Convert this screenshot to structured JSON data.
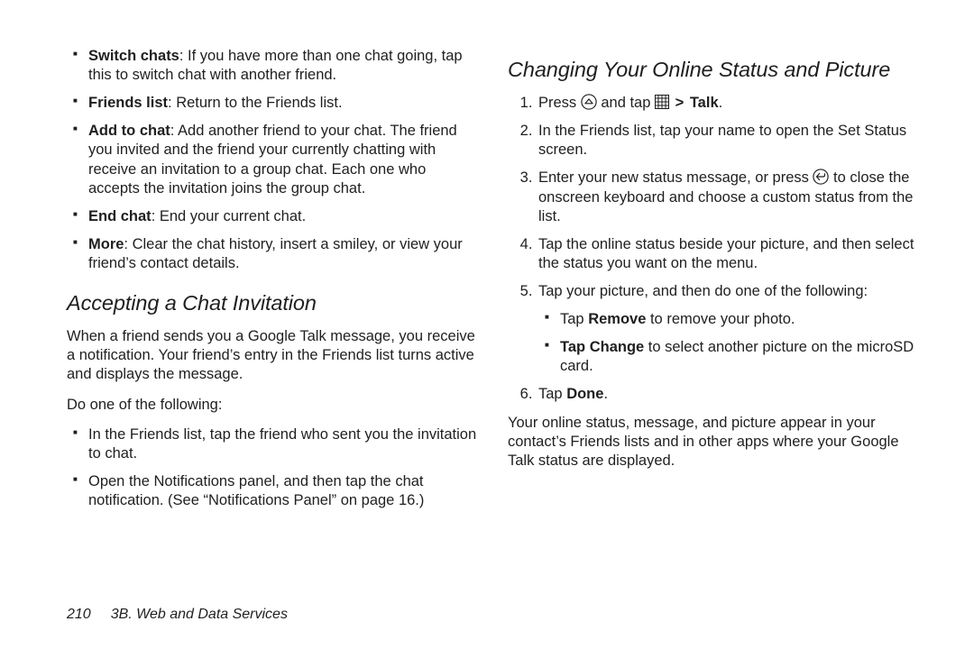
{
  "left": {
    "switch_chats_term": "Switch chats",
    "switch_chats_body": ": If you have more than one chat going, tap this to switch chat with another friend.",
    "friends_list_term": "Friends list",
    "friends_list_body": ": Return to the Friends list.",
    "add_to_chat_term": "Add to chat",
    "add_to_chat_body": ": Add another friend to your chat. The friend you invited and the friend your currently chatting with receive an invitation to a group chat. Each one who accepts the invitation joins the group chat.",
    "end_chat_term": "End chat",
    "end_chat_body": ": End your current chat.",
    "more_term": "More",
    "more_body": ": Clear the chat history, insert a smiley, or view your friend’s contact details.",
    "heading_accept": "Accepting a Chat Invitation",
    "accept_para": "When a friend sends you a Google Talk message, you receive a notification. Your friend’s entry in the Friends list turns active and displays the message.",
    "do_one": "Do one of the following:",
    "do_a": "In the Friends list, tap the friend who sent you the invitation to chat.",
    "do_b": "Open the Notifications panel, and then tap the chat notification. (See “Notifications Panel” on page 16.)"
  },
  "right": {
    "heading_status": "Changing Your Online Status and Picture",
    "step1_a": "Press ",
    "step1_b": " and tap ",
    "step1_talk": "Talk",
    "step1_c": ".",
    "step2": "In the Friends list, tap your name to open the Set Status screen.",
    "step3_a": "Enter your new status message, or press ",
    "step3_b": " to close the onscreen keyboard and choose a custom status from the list.",
    "step4": "Tap the online status beside your picture, and then select the status you want on the menu.",
    "step5": "Tap your picture, and then do one of the following:",
    "step5_sub1_a": "Tap ",
    "step5_sub1_bold": "Remove",
    "step5_sub1_b": " to remove your photo.",
    "step5_sub2_bold": "Tap Change",
    "step5_sub2_b": " to select another picture on the microSD card.",
    "step6_a": "Tap ",
    "step6_bold": "Done",
    "step6_b": ".",
    "closing": "Your online status, message, and picture appear in your contact’s Friends lists and in other apps where your Google Talk status are displayed."
  },
  "footer": {
    "page_number": "210",
    "section_label": "3B. Web and Data Services"
  },
  "gt": ">"
}
